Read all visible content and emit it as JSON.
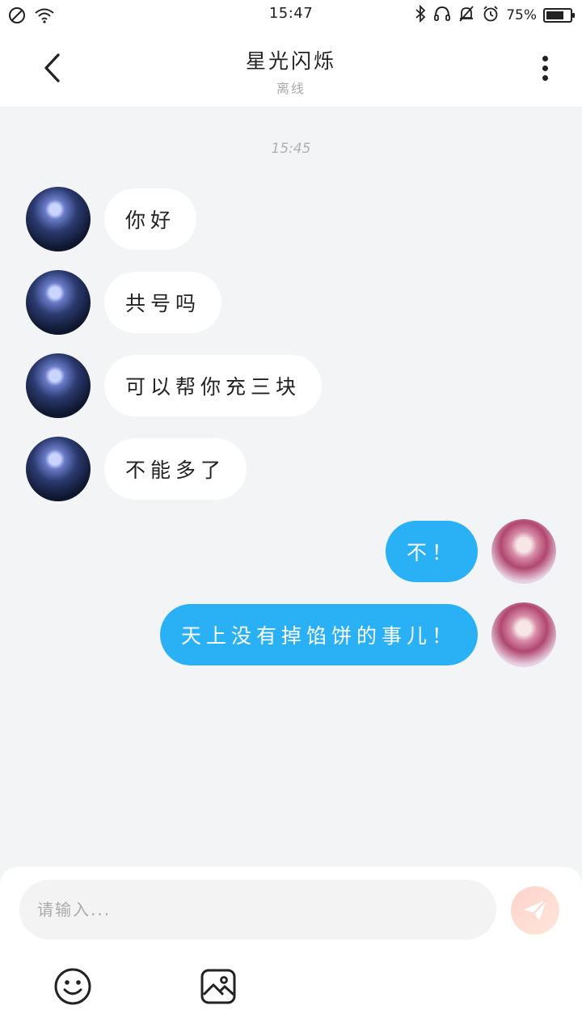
{
  "status_bar": {
    "time": "15:47",
    "battery_percent": "75%",
    "battery_level": 0.75,
    "icons_left": [
      "dnd-icon",
      "wifi-icon"
    ],
    "icons_right": [
      "bluetooth-icon",
      "headset-icon",
      "mute-bell-icon",
      "alarm-icon"
    ]
  },
  "header": {
    "title": "星光闪烁",
    "subtitle": "离线"
  },
  "chat": {
    "timestamp": "15:45",
    "messages": [
      {
        "side": "in",
        "text": "你好"
      },
      {
        "side": "in",
        "text": "共号吗"
      },
      {
        "side": "in",
        "text": "可以帮你充三块"
      },
      {
        "side": "in",
        "text": "不能多了"
      },
      {
        "side": "out",
        "text": "不！"
      },
      {
        "side": "out",
        "text": "天上没有掉馅饼的事儿！"
      }
    ]
  },
  "composer": {
    "placeholder": "请输入..."
  },
  "colors": {
    "outgoing_bubble": "#2ab1f5",
    "incoming_bubble": "#ffffff",
    "background": "#f3f4f6"
  }
}
